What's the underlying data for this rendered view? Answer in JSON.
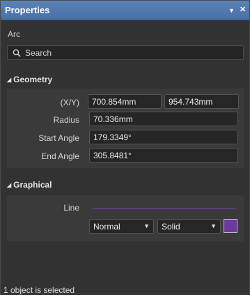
{
  "window": {
    "title": "Properties",
    "pin_icon": "▼",
    "close_icon": "✕"
  },
  "object_type": "Arc",
  "search": {
    "placeholder": "Search"
  },
  "geometry": {
    "header": "Geometry",
    "xy_label": "(X/Y)",
    "x": "700.854mm",
    "y": "954.743mm",
    "radius_label": "Radius",
    "radius": "70.336mm",
    "start_angle_label": "Start Angle",
    "start_angle": "179.3349°",
    "end_angle_label": "End Angle",
    "end_angle": "305.8481°"
  },
  "graphical": {
    "header": "Graphical",
    "line_label": "Line",
    "line_width": "Normal",
    "line_style": "Solid",
    "color": "#6b3aa1"
  },
  "status": "1 object is selected"
}
